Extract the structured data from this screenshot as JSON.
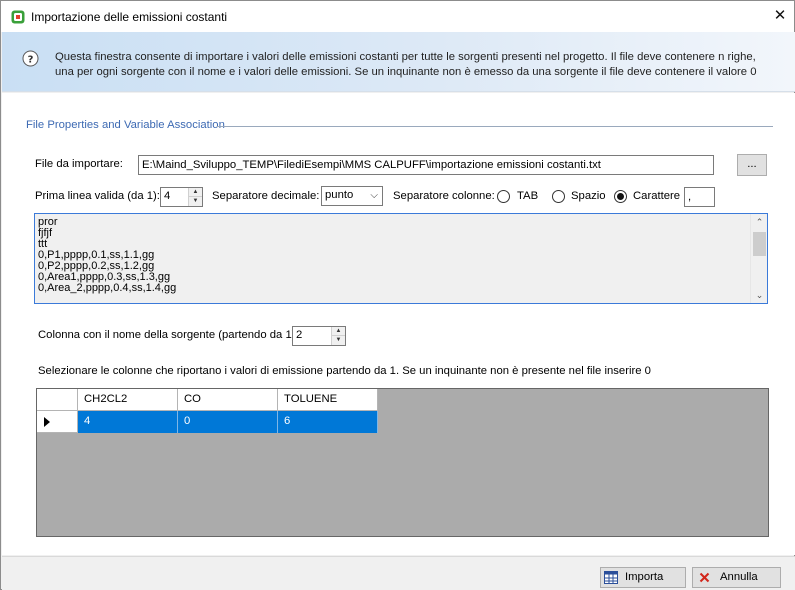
{
  "window": {
    "title": "Importazione delle emissioni costanti",
    "close_glyph": "✕"
  },
  "banner": {
    "icon": "info-icon",
    "text": "Questa finestra consente di importare i valori delle emissioni costanti per tutte le sorgenti presenti nel progetto. Il file deve contenere n righe, una per ogni sorgente con il nome e i valori delle emissioni. Se un inquinante non è emesso da una sorgente il file deve contenere il valore 0"
  },
  "group": {
    "title": "File Properties and Variable Association"
  },
  "file": {
    "label": "File da importare:",
    "path": "E:\\Maind_Sviluppo_TEMP\\FilediEsempi\\MMS CALPUFF\\importazione emissioni costanti.txt",
    "browse_label": "..."
  },
  "options": {
    "first_line_label": "Prima linea valida (da 1):",
    "first_line_value": "4",
    "decimal_sep_label": "Separatore decimale:",
    "decimal_sep_value": "punto",
    "col_sep_label": "Separatore colonne:",
    "radio_tab": "TAB",
    "radio_space": "Spazio",
    "radio_char": "Carattere",
    "char_value": ",",
    "selected_separator": "Carattere"
  },
  "preview_lines": [
    "pror",
    "fjfjf",
    "ttt",
    "0,P1,pppp,0.1,ss,1.1,gg",
    "0,P2,pppp,0.2,ss,1.2,gg",
    "0,Area1,pppp,0.3,ss,1.3,gg",
    "0,Area_2,pppp,0.4,ss,1.4,gg"
  ],
  "source_col": {
    "label": "Colonna con il nome della sorgente (partendo da 1):",
    "value": "2"
  },
  "columns_hint": "Selezionare le colonne che riportano i valori di emissione partendo da 1. Se un inquinante non è presente nel file inserire 0",
  "grid": {
    "headers": [
      "CH2CL2",
      "CO",
      "TOLUENE"
    ],
    "rows": [
      [
        "4",
        "0",
        "6"
      ]
    ],
    "selection_color": "#0078d7"
  },
  "buttons": {
    "import_label": "Importa",
    "cancel_label": "Annulla"
  }
}
